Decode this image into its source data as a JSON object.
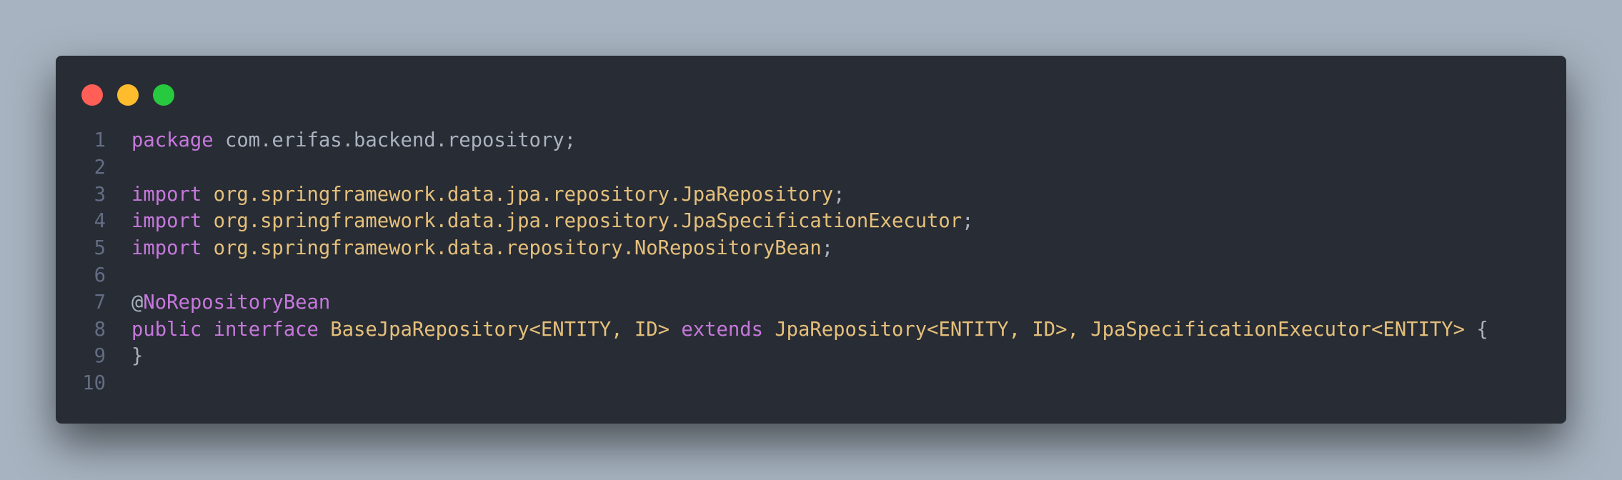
{
  "window": {
    "buttons": [
      "close",
      "minimize",
      "maximize"
    ],
    "colors": {
      "close": "#ff5f56",
      "minimize": "#ffbd2e",
      "maximize": "#27c93f",
      "background": "#282c34",
      "keyword": "#c678dd",
      "type": "#e5c07b",
      "plain": "#abb2bf",
      "line_number": "#636d83"
    }
  },
  "code": {
    "lines": [
      {
        "number": "1",
        "tokens": [
          {
            "text": "package",
            "kind": "kw"
          },
          {
            "text": " com.erifas.backend.repository;",
            "kind": "pl"
          }
        ]
      },
      {
        "number": "2",
        "tokens": []
      },
      {
        "number": "3",
        "tokens": [
          {
            "text": "import",
            "kind": "kw"
          },
          {
            "text": " ",
            "kind": "pl"
          },
          {
            "text": "org.springframework.data.jpa.repository.JpaRepository",
            "kind": "ty"
          },
          {
            "text": ";",
            "kind": "pl"
          }
        ]
      },
      {
        "number": "4",
        "tokens": [
          {
            "text": "import",
            "kind": "kw"
          },
          {
            "text": " ",
            "kind": "pl"
          },
          {
            "text": "org.springframework.data.jpa.repository.JpaSpecificationExecutor",
            "kind": "ty"
          },
          {
            "text": ";",
            "kind": "pl"
          }
        ]
      },
      {
        "number": "5",
        "tokens": [
          {
            "text": "import",
            "kind": "kw"
          },
          {
            "text": " ",
            "kind": "pl"
          },
          {
            "text": "org.springframework.data.repository.NoRepositoryBean",
            "kind": "ty"
          },
          {
            "text": ";",
            "kind": "pl"
          }
        ]
      },
      {
        "number": "6",
        "tokens": []
      },
      {
        "number": "7",
        "tokens": [
          {
            "text": "@",
            "kind": "pl"
          },
          {
            "text": "NoRepositoryBean",
            "kind": "kw"
          }
        ]
      },
      {
        "number": "8",
        "tokens": [
          {
            "text": "public",
            "kind": "kw"
          },
          {
            "text": " ",
            "kind": "pl"
          },
          {
            "text": "interface",
            "kind": "kw"
          },
          {
            "text": " ",
            "kind": "pl"
          },
          {
            "text": "BaseJpaRepository<ENTITY, ID>",
            "kind": "ty"
          },
          {
            "text": " ",
            "kind": "pl"
          },
          {
            "text": "extends",
            "kind": "kw"
          },
          {
            "text": " ",
            "kind": "pl"
          },
          {
            "text": "JpaRepository<ENTITY, ID>, JpaSpecificationExecutor<ENTITY>",
            "kind": "ty"
          },
          {
            "text": " {",
            "kind": "pl"
          }
        ]
      },
      {
        "number": "9",
        "tokens": [
          {
            "text": "}",
            "kind": "pl"
          }
        ]
      },
      {
        "number": "10",
        "tokens": []
      }
    ]
  }
}
